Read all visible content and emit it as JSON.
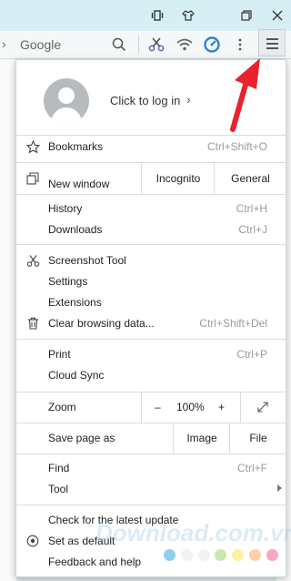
{
  "window": {
    "restore_label": "❐",
    "close_label": "✕"
  },
  "toolbar": {
    "search_engine": "Google"
  },
  "profile": {
    "login_label": "Click to log in",
    "arrow": "›"
  },
  "menu": {
    "bookmarks": {
      "label": "Bookmarks",
      "shortcut": "Ctrl+Shift+O"
    },
    "new_window": {
      "label": "New window",
      "incognito": "Incognito",
      "general": "General"
    },
    "history": {
      "label": "History",
      "shortcut": "Ctrl+H"
    },
    "downloads": {
      "label": "Downloads",
      "shortcut": "Ctrl+J"
    },
    "screenshot_tool": {
      "label": "Screenshot Tool"
    },
    "settings": {
      "label": "Settings"
    },
    "extensions": {
      "label": "Extensions"
    },
    "clear_data": {
      "label": "Clear browsing data...",
      "shortcut": "Ctrl+Shift+Del"
    },
    "print": {
      "label": "Print",
      "shortcut": "Ctrl+P"
    },
    "cloud_sync": {
      "label": "Cloud Sync"
    },
    "zoom": {
      "label": "Zoom",
      "minus": "–",
      "value": "100%",
      "plus": "+"
    },
    "save_page": {
      "label": "Save page as",
      "image": "Image",
      "file": "File"
    },
    "find": {
      "label": "Find",
      "shortcut": "Ctrl+F"
    },
    "tool": {
      "label": "Tool"
    },
    "check_update": {
      "label": "Check for the latest update"
    },
    "set_default": {
      "label": "Set as default"
    },
    "feedback": {
      "label": "Feedback and help"
    }
  },
  "watermark": {
    "text": "Download.com.vn"
  },
  "colors": {
    "accent_arrow": "#e8232d",
    "titlebar": "#d7eef4",
    "dots": [
      "#8fcff0",
      "#f7c8d8",
      "#c8e8b0",
      "#fff0a0",
      "#ffd0a8",
      "#f7a8c0",
      "#a8d8f8"
    ]
  }
}
